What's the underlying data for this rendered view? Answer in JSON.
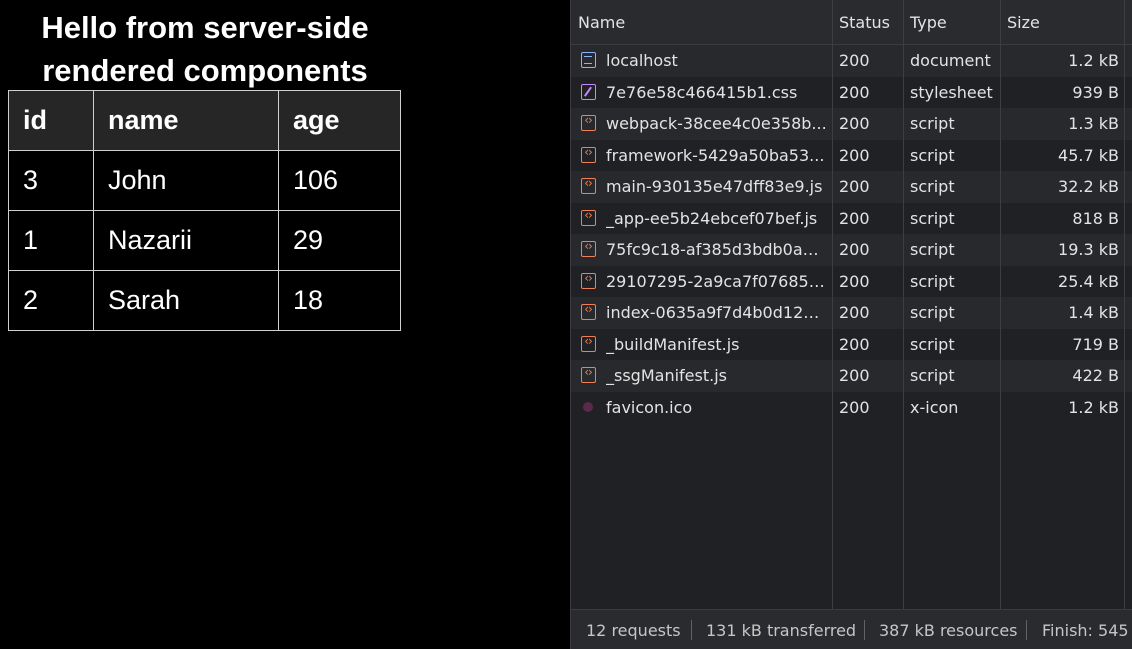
{
  "page": {
    "heading": "Hello from server-side rendered components",
    "table": {
      "headers": [
        "id",
        "name",
        "age"
      ],
      "rows": [
        [
          "3",
          "John",
          "106"
        ],
        [
          "1",
          "Nazarii",
          "29"
        ],
        [
          "2",
          "Sarah",
          "18"
        ]
      ]
    }
  },
  "network": {
    "columns": {
      "name": "Name",
      "status": "Status",
      "type": "Type",
      "size": "Size"
    },
    "requests": [
      {
        "icon": "document-icon",
        "name": "localhost",
        "status": "200",
        "type": "document",
        "size": "1.2 kB"
      },
      {
        "icon": "stylesheet-icon",
        "name": "7e76e58c466415b1.css",
        "status": "200",
        "type": "stylesheet",
        "size": "939 B"
      },
      {
        "icon": "script-icon",
        "name": "webpack-38cee4c0e358b...",
        "status": "200",
        "type": "script",
        "size": "1.3 kB"
      },
      {
        "icon": "script-icon",
        "name": "framework-5429a50ba53...",
        "status": "200",
        "type": "script",
        "size": "45.7 kB"
      },
      {
        "icon": "script-icon",
        "name": "main-930135e47dff83e9.js",
        "status": "200",
        "type": "script",
        "size": "32.2 kB"
      },
      {
        "icon": "script-icon",
        "name": "_app-ee5b24ebcef07bef.js",
        "status": "200",
        "type": "script",
        "size": "818 B"
      },
      {
        "icon": "script-icon",
        "name": "75fc9c18-af385d3bdb0a9...",
        "status": "200",
        "type": "script",
        "size": "19.3 kB"
      },
      {
        "icon": "script-icon",
        "name": "29107295-2a9ca7f07685b...",
        "status": "200",
        "type": "script",
        "size": "25.4 kB"
      },
      {
        "icon": "script-icon",
        "name": "index-0635a9f7d4b0d12e.js",
        "status": "200",
        "type": "script",
        "size": "1.4 kB"
      },
      {
        "icon": "script-icon",
        "name": "_buildManifest.js",
        "status": "200",
        "type": "script",
        "size": "719 B"
      },
      {
        "icon": "script-icon",
        "name": "_ssgManifest.js",
        "status": "200",
        "type": "script",
        "size": "422 B"
      },
      {
        "icon": "favicon-icon",
        "name": "favicon.ico",
        "status": "200",
        "type": "x-icon",
        "size": "1.2 kB"
      }
    ],
    "summary": {
      "requests": "12 requests",
      "transferred": "131 kB transferred",
      "resources": "387 kB resources",
      "finish": "Finish: 545"
    }
  }
}
